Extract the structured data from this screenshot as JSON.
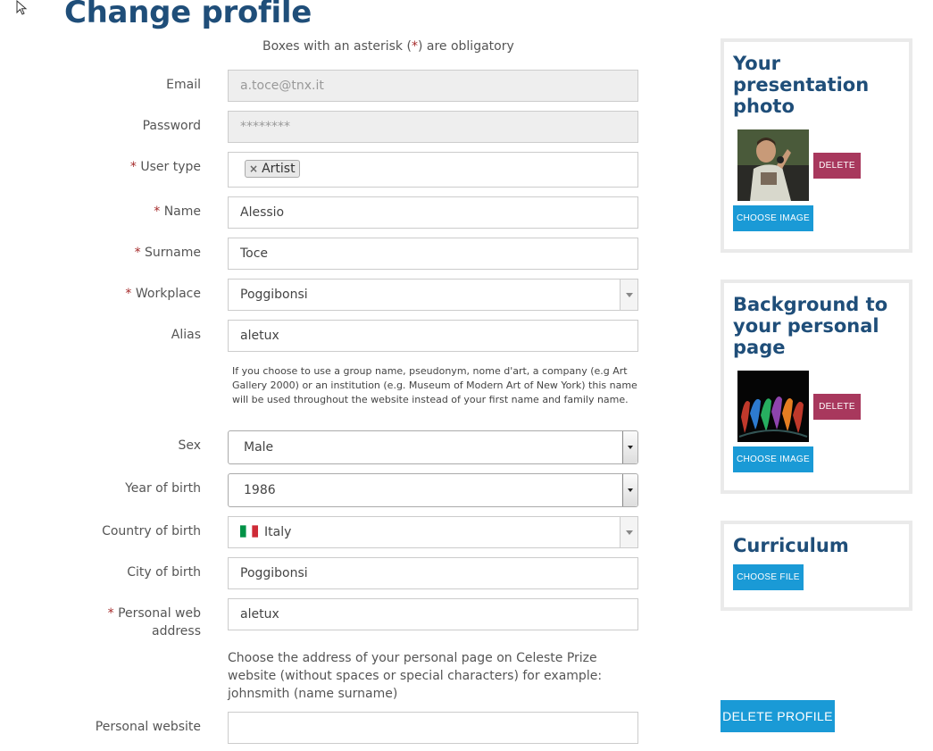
{
  "page": {
    "title": "Change profile",
    "obligatory_prefix": "Boxes with an asterisk (",
    "obligatory_star": "*",
    "obligatory_suffix": ") are obligatory"
  },
  "form": {
    "email": {
      "label": "Email",
      "value": "a.toce@tnx.it"
    },
    "password": {
      "label": "Password",
      "value": "********"
    },
    "user_type": {
      "label": "User type",
      "tag": "Artist",
      "tag_remove": "×"
    },
    "name": {
      "label": "Name",
      "value": "Alessio"
    },
    "surname": {
      "label": "Surname",
      "value": "Toce"
    },
    "workplace": {
      "label": "Workplace",
      "value": "Poggibonsi"
    },
    "alias": {
      "label": "Alias",
      "value": "aletux",
      "help": "If you choose to use a group name, pseudonym, nome d'art, a company (e.g Art Gallery 2000) or an institution (e.g. Museum of Modern Art of New York) this name will be used throughout the website instead of your first name and family name."
    },
    "sex": {
      "label": "Sex",
      "value": "Male"
    },
    "year_of_birth": {
      "label": "Year of birth",
      "value": "1986"
    },
    "country_of_birth": {
      "label": "Country of birth",
      "value": "Italy",
      "flag_icon": "italy-flag-icon"
    },
    "city_of_birth": {
      "label": "City of birth",
      "value": "Poggibonsi"
    },
    "personal_web_address": {
      "label_line1": "Personal web",
      "label_line2": "address",
      "value": "aletux",
      "help": "Choose the address of your personal page on Celeste Prize website (without spaces or special characters) for example: johnsmith (name surname)"
    },
    "personal_website": {
      "label": "Personal website",
      "value": ""
    },
    "required_star": "*"
  },
  "sidebar": {
    "photo": {
      "title": "Your presentation photo",
      "delete_label": "DELETE",
      "choose_label": "CHOOSE IMAGE"
    },
    "background": {
      "title": "Background to your personal page",
      "delete_label": "DELETE",
      "choose_label": "CHOOSE IMAGE"
    },
    "curriculum": {
      "title": "Curriculum",
      "choose_label": "CHOOSE FILE"
    },
    "delete_profile_label": "DELETE PROFILE"
  },
  "colors": {
    "title": "#1f4e79",
    "asterisk": "#a52a2a",
    "primary_button": "#1a9ad6",
    "delete_button": "#a8385d"
  }
}
